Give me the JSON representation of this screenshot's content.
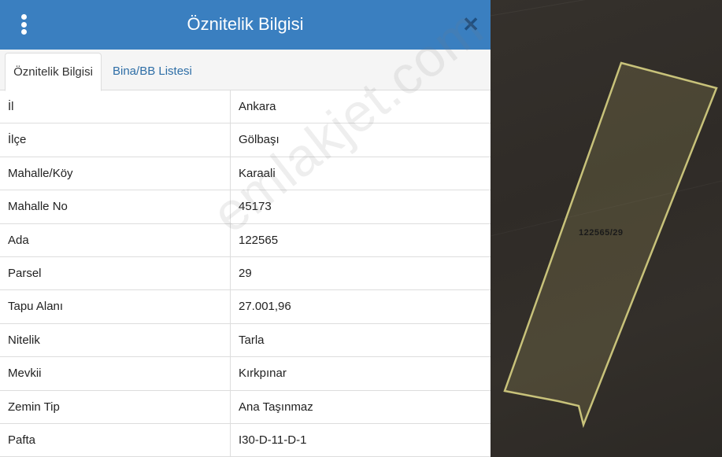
{
  "header": {
    "title": "Öznitelik Bilgisi",
    "close_glyph": "✕"
  },
  "tabs": [
    {
      "label": "Öznitelik Bilgisi",
      "active": true
    },
    {
      "label": "Bina/BB Listesi",
      "active": false
    }
  ],
  "rows": [
    {
      "key": "İl",
      "value": "Ankara"
    },
    {
      "key": "İlçe",
      "value": "Gölbaşı"
    },
    {
      "key": "Mahalle/Köy",
      "value": "Karaali"
    },
    {
      "key": "Mahalle No",
      "value": "45173"
    },
    {
      "key": "Ada",
      "value": "122565"
    },
    {
      "key": "Parsel",
      "value": "29"
    },
    {
      "key": "Tapu Alanı",
      "value": "27.001,96"
    },
    {
      "key": "Nitelik",
      "value": "Tarla"
    },
    {
      "key": "Mevkii",
      "value": "Kırkpınar"
    },
    {
      "key": "Zemin Tip",
      "value": "Ana Taşınmaz"
    },
    {
      "key": "Pafta",
      "value": "I30-D-11-D-1"
    }
  ],
  "watermark": "emlakjet.com",
  "map": {
    "parcel_label": "122565/29"
  },
  "colors": {
    "header": "#3a7fc0",
    "tab_text": "#2e6ea6",
    "parcel_outline": "#c8c27a"
  },
  "icons": {
    "menu": "vertical-dots-icon",
    "close": "close-icon"
  }
}
